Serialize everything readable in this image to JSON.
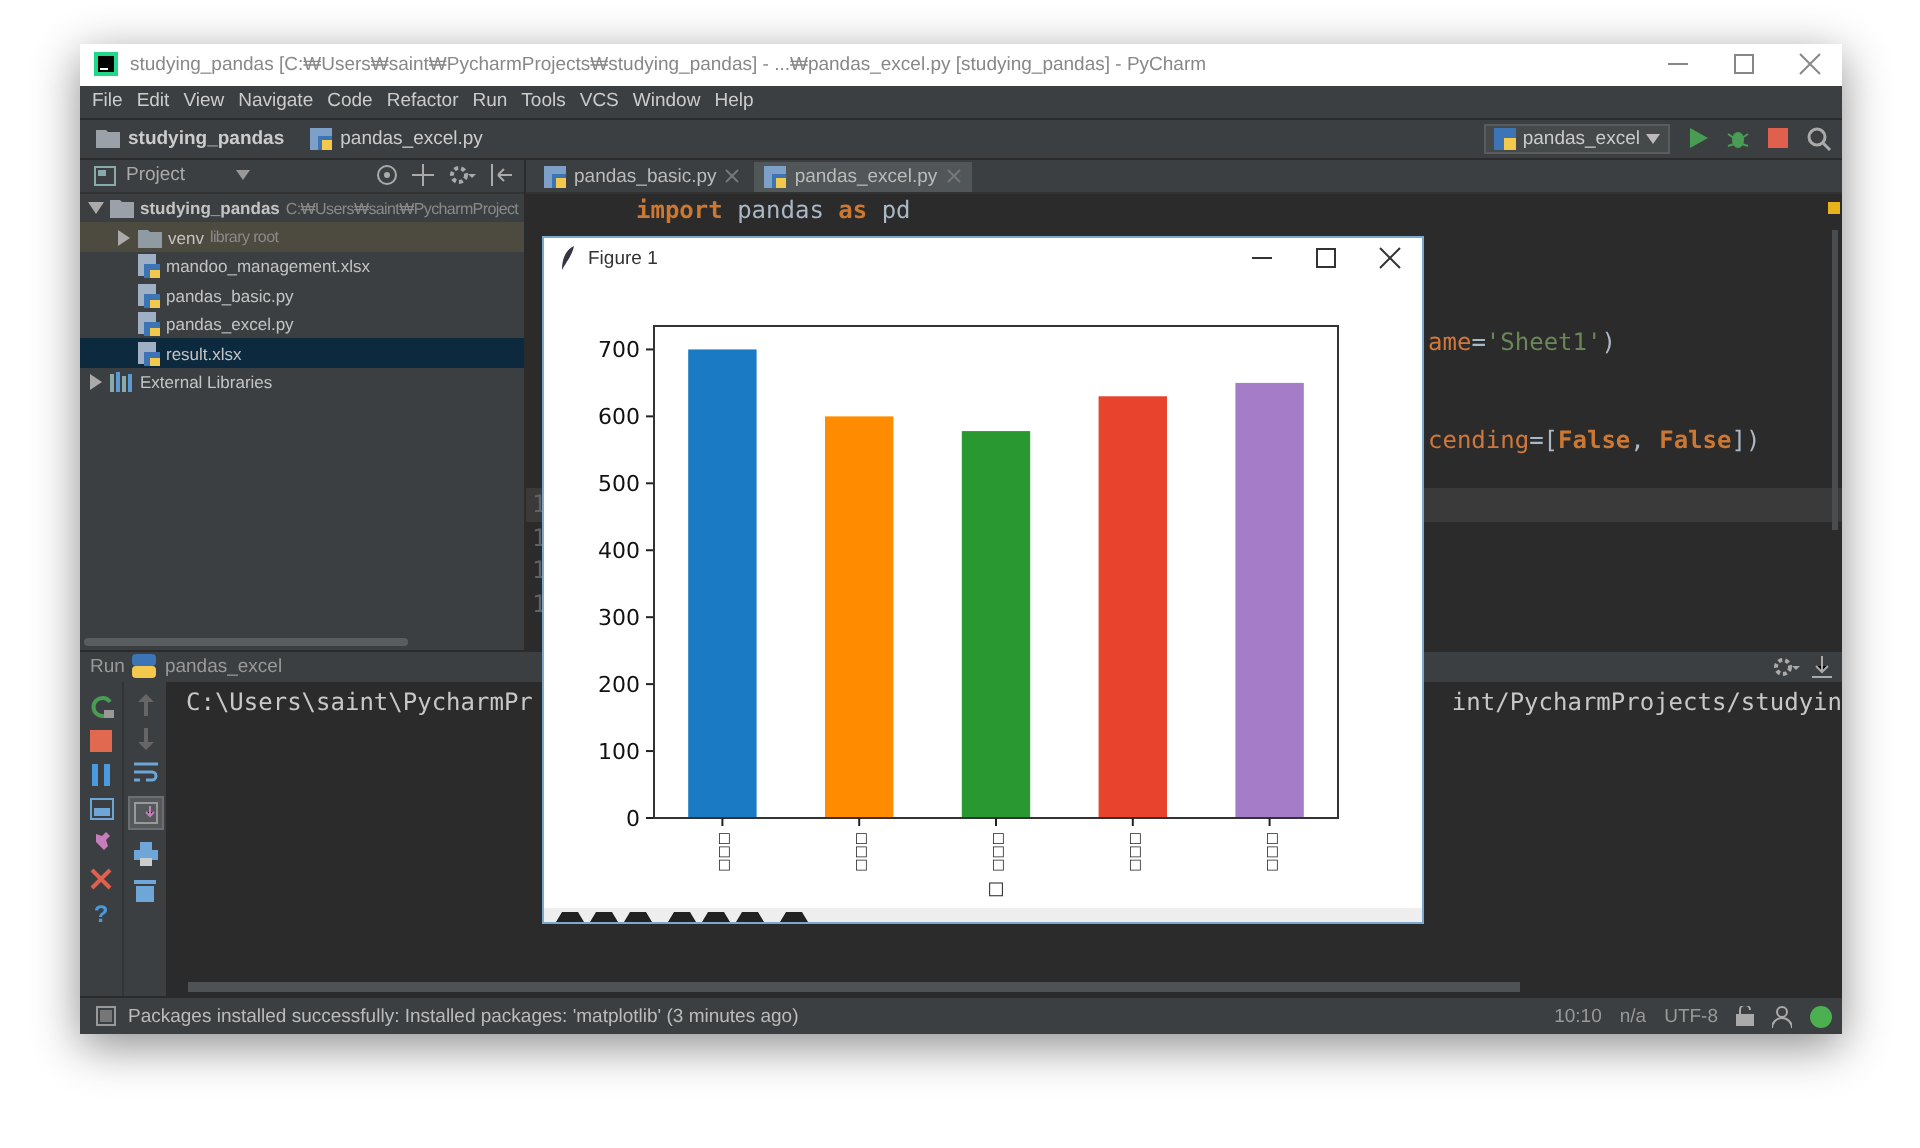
{
  "window": {
    "title": "studying_pandas [C:₩Users₩saint₩PycharmProjects₩studying_pandas] - ...₩pandas_excel.py [studying_pandas] - PyCharm"
  },
  "menu": [
    "File",
    "Edit",
    "View",
    "Navigate",
    "Code",
    "Refactor",
    "Run",
    "Tools",
    "VCS",
    "Window",
    "Help"
  ],
  "breadcrumb": [
    {
      "label": "studying_pandas",
      "kind": "folder"
    },
    {
      "label": "pandas_excel.py",
      "kind": "python"
    }
  ],
  "run_config": {
    "label": "pandas_excel"
  },
  "project_panel": {
    "title": "Project",
    "tree": [
      {
        "label": "studying_pandas",
        "kind": "folder",
        "hint": "C:₩Users₩saint₩PycharmProject",
        "expanded": true,
        "selected": false,
        "children": [
          {
            "label": "venv",
            "kind": "root",
            "hint": "library root",
            "expanded": false,
            "selected": false
          },
          {
            "label": "mandoo_management.xlsx",
            "kind": "file",
            "selected": false
          },
          {
            "label": "pandas_basic.py",
            "kind": "file",
            "selected": false
          },
          {
            "label": "pandas_excel.py",
            "kind": "file",
            "selected": false
          },
          {
            "label": "result.xlsx",
            "kind": "file",
            "selected": true
          }
        ]
      },
      {
        "label": "External Libraries",
        "kind": "library",
        "expanded": false,
        "selected": false
      }
    ]
  },
  "editor": {
    "tabs": [
      {
        "label": "pandas_basic.py",
        "selected": false
      },
      {
        "label": "pandas_excel.py",
        "selected": true
      }
    ],
    "lines": [
      {
        "kind": "full",
        "current": false,
        "tokens": [
          {
            "text": "import",
            "kind": "keyword"
          },
          {
            "text": " pandas ",
            "kind": "plain"
          },
          {
            "text": "as",
            "kind": "keyword"
          },
          {
            "text": " pd",
            "kind": "plain"
          }
        ]
      },
      {
        "kind": "blank",
        "current": false
      },
      {
        "kind": "blank",
        "current": false
      },
      {
        "kind": "blank",
        "current": false
      },
      {
        "kind": "partial",
        "current": false,
        "tokens": [
          {
            "text": "ame",
            "kind": "param"
          },
          {
            "text": "=",
            "kind": "plain"
          },
          {
            "text": "'Sheet1'",
            "kind": "string"
          },
          {
            "text": ")",
            "kind": "plain"
          }
        ]
      },
      {
        "kind": "blank",
        "current": false
      },
      {
        "kind": "blank",
        "current": false
      },
      {
        "kind": "partial",
        "current": false,
        "tokens": [
          {
            "text": "cending",
            "kind": "param"
          },
          {
            "text": "=[",
            "kind": "plain"
          },
          {
            "text": "False",
            "kind": "keyword"
          },
          {
            "text": ", ",
            "kind": "plain"
          },
          {
            "text": "False",
            "kind": "keyword"
          },
          {
            "text": "])",
            "kind": "plain"
          }
        ]
      },
      {
        "kind": "blank",
        "current": false
      },
      {
        "kind": "blank",
        "current": true,
        "number": "1"
      },
      {
        "kind": "blank",
        "current": false,
        "number": "1"
      },
      {
        "kind": "blank",
        "current": false,
        "number": "1"
      },
      {
        "kind": "blank",
        "current": false,
        "number": "1"
      }
    ]
  },
  "figure": {
    "title": "Figure 1",
    "chart_data": {
      "type": "bar",
      "xlabel": "□",
      "categories": [
        "□□□",
        "□□□",
        "□□□",
        "□□□",
        "□□□"
      ],
      "values": [
        700,
        600,
        578,
        630,
        650
      ],
      "colors": [
        "#1a7bc4",
        "#ff8c00",
        "#2a9830",
        "#e8432c",
        "#a47cc8"
      ],
      "ylim": [
        0,
        735
      ],
      "yticks": [
        0,
        100,
        200,
        300,
        400,
        500,
        600,
        700
      ]
    }
  },
  "run_panel": {
    "title": "Run",
    "config": "pandas_excel",
    "console_left": "C:\\Users\\saint\\PycharmPr",
    "console_right": "int/PycharmProjects/studyin",
    "help_glyph": "?"
  },
  "status_bar": {
    "message": "Packages installed successfully: Installed packages: 'matplotlib' (3 minutes ago)",
    "position": "10:10",
    "line_sep": "n/a",
    "encoding": "UTF-8"
  }
}
